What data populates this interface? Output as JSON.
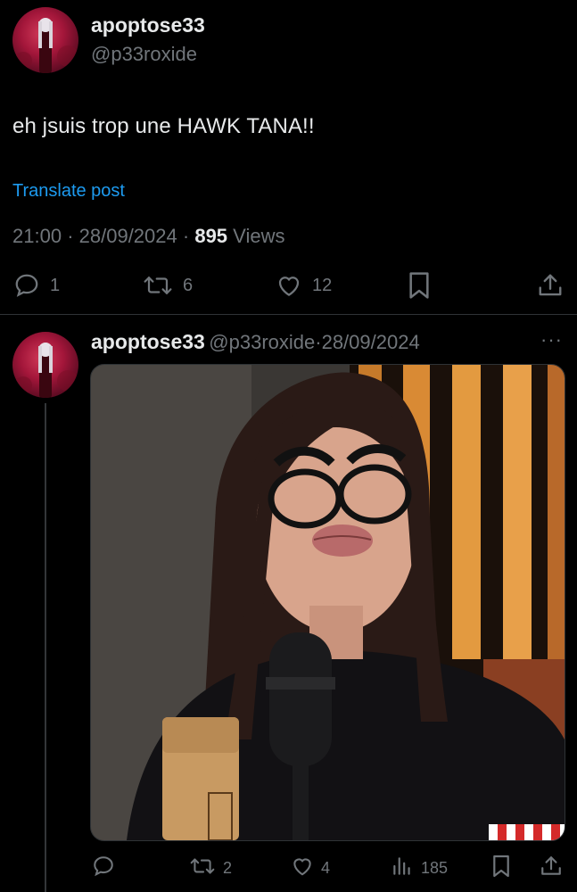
{
  "post": {
    "display_name": "apoptose33",
    "handle": "@p33roxide",
    "text": "eh jsuis trop une HAWK TANA!!",
    "translate_label": "Translate post",
    "time": "21:00",
    "separator": "·",
    "date": "28/09/2024",
    "views_count": "895",
    "views_label": "Views",
    "actions": {
      "replies": "1",
      "reposts": "6",
      "likes": "12"
    }
  },
  "reply": {
    "display_name": "apoptose33",
    "handle": "@p33roxide",
    "separator": "·",
    "date": "28/09/2024",
    "more_label": "···",
    "actions": {
      "reposts": "2",
      "likes": "4",
      "views": "185"
    }
  },
  "colors": {
    "background": "#000000",
    "text_primary": "#e7e9ea",
    "text_secondary": "#71767b",
    "link": "#1d9bf0",
    "divider": "#2f3336",
    "avatar_red": "#a3163a"
  },
  "icons": {
    "reply": "speech-bubble-icon",
    "repost": "repost-arrows-icon",
    "like": "heart-icon",
    "bookmark": "bookmark-icon",
    "share": "share-upload-icon",
    "views": "bar-chart-icon",
    "more": "ellipsis-icon"
  }
}
